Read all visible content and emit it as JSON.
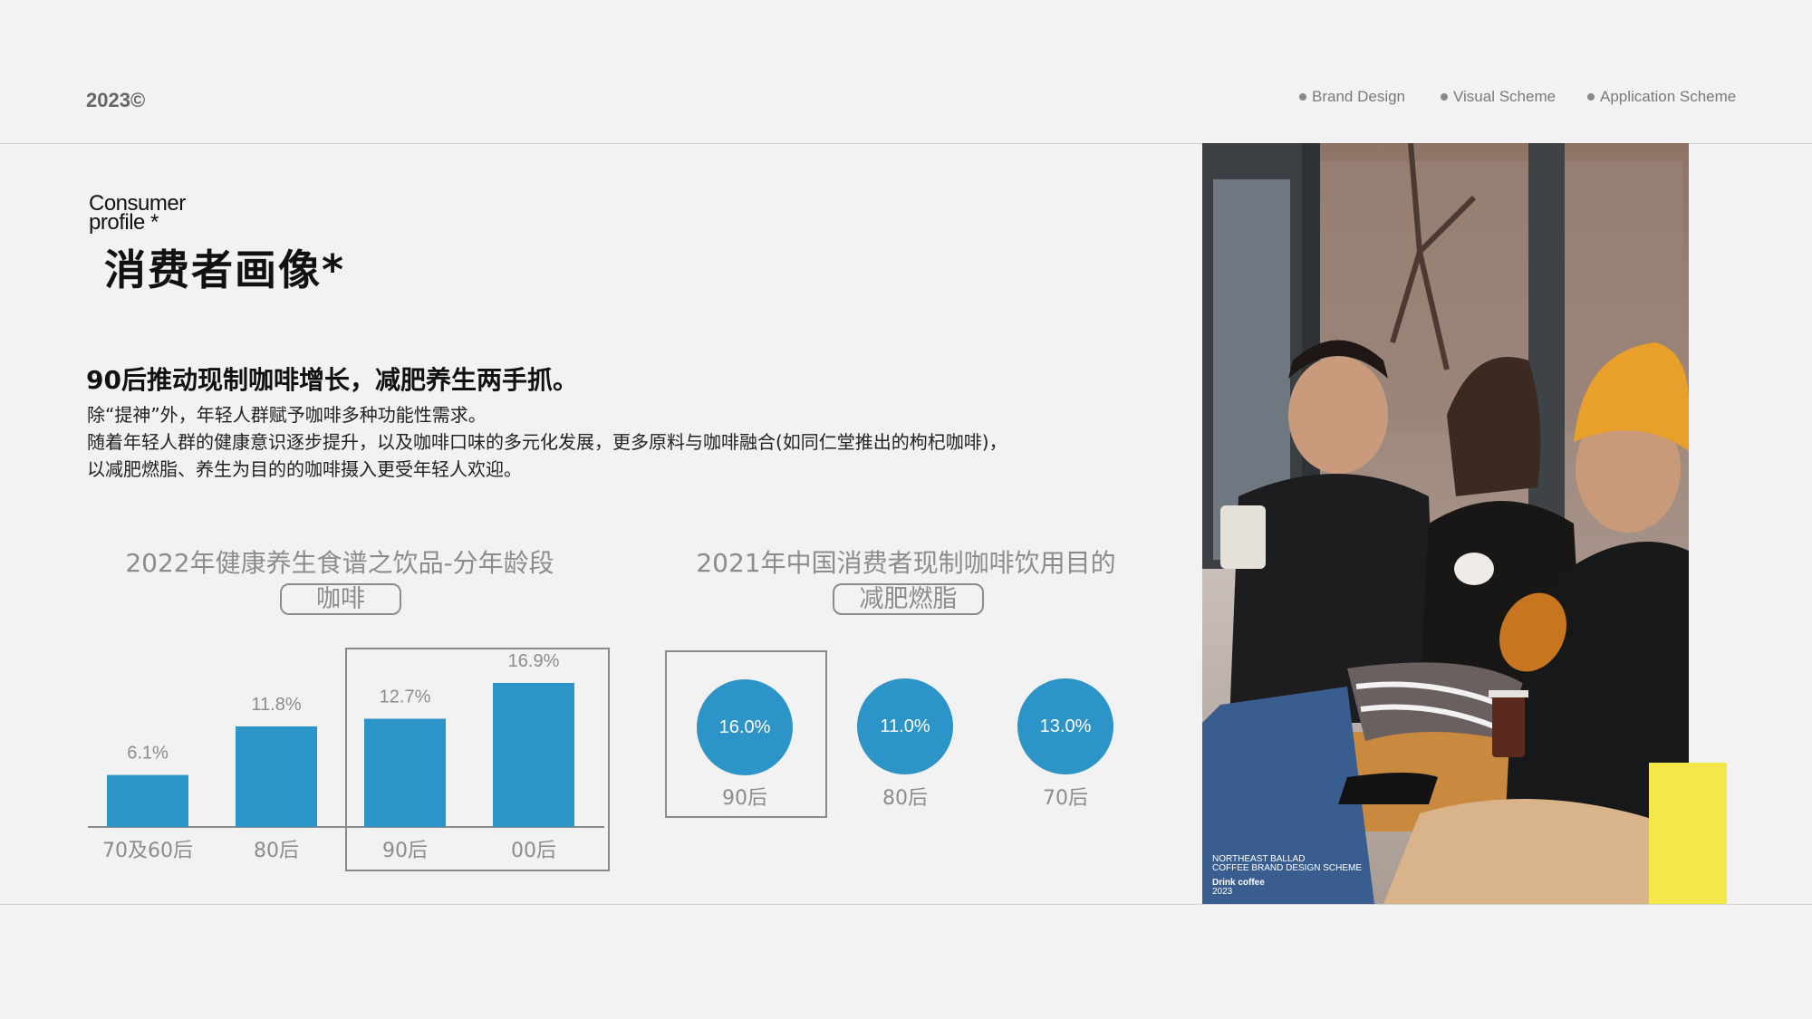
{
  "header": {
    "year": "2023©",
    "nav": [
      "Brand Design",
      "Visual Scheme",
      "Application Scheme"
    ]
  },
  "title": {
    "en_line1": "Consumer",
    "en_line2": "profile *",
    "cn": "消费者画像*"
  },
  "intro": {
    "headline": "90后推动现制咖啡增长，减肥养生两手抓。",
    "lines": [
      "除“提神”外，年轻人群赋予咖啡多种功能性需求。",
      "随着年轻人群的健康意识逐步提升，以及咖啡口味的多元化发展，更多原料与咖啡融合(如同仁堂推出的枸杞咖啡)，",
      "以减肥燃脂、养生为目的的咖啡摄入更受年轻人欢迎。"
    ]
  },
  "section1": {
    "title": "2022年健康养生食谱之饮品-分年龄段",
    "tag": "咖啡"
  },
  "section2": {
    "title": "2021年中国消费者现制咖啡饮用目的",
    "tag": "减肥燃脂"
  },
  "chart_data": [
    {
      "type": "bar",
      "categories": [
        "70及60后",
        "80后",
        "90后",
        "00后"
      ],
      "values": [
        6.1,
        11.8,
        12.7,
        16.9
      ],
      "value_labels": [
        "6.1%",
        "11.8%",
        "12.7%",
        "16.9%"
      ],
      "title": "2022年健康养生食谱之饮品-分年龄段",
      "subtitle": "咖啡",
      "color": "#2d94c8",
      "highlighted_categories": [
        "90后",
        "00后"
      ]
    },
    {
      "type": "bubble",
      "categories": [
        "90后",
        "80后",
        "70后"
      ],
      "values": [
        16.0,
        11.0,
        13.0
      ],
      "value_labels": [
        "16.0%",
        "11.0%",
        "13.0%"
      ],
      "title": "2021年中国消费者现制咖啡饮用目的",
      "subtitle": "减肥燃脂",
      "color": "#2d94c8",
      "highlighted_categories": [
        "90后"
      ]
    }
  ],
  "photo": {
    "caption_line1": "NORTHEAST BALLAD",
    "caption_line2": "COFFEE BRAND DESIGN SCHEME",
    "caption_line3": "Drink coffee",
    "caption_line4": "2023"
  },
  "colors": {
    "accent": "#2d94c8",
    "yellow": "#f5e64a",
    "background": "#f2f2f2"
  }
}
